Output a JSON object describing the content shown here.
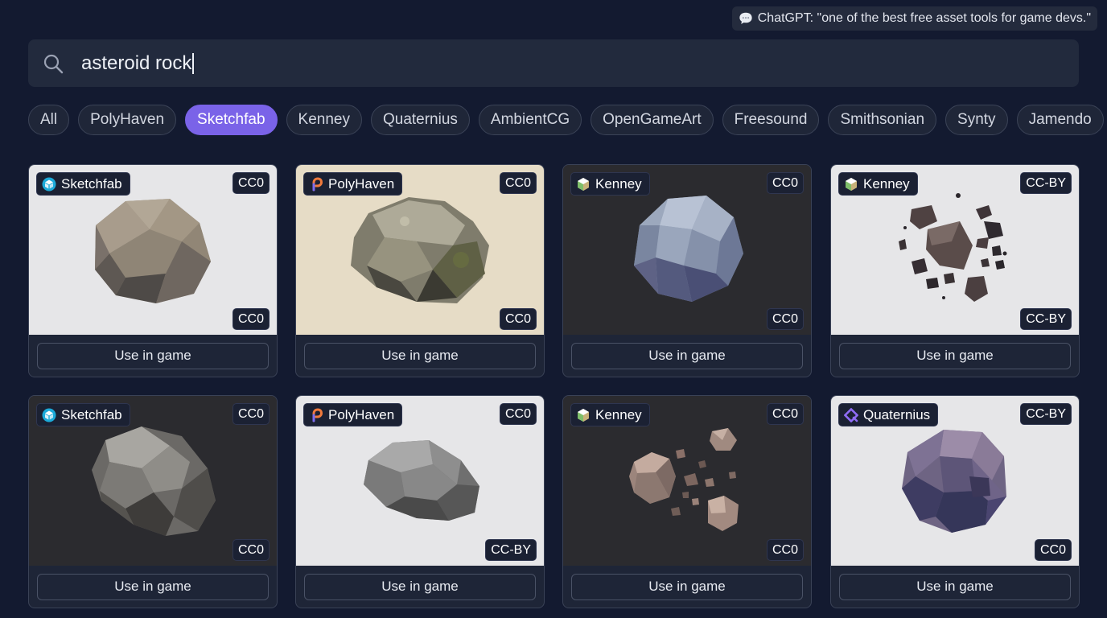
{
  "toast": {
    "icon": "speech-bubble-icon",
    "text": "ChatGPT: \"one of the best free asset tools for game devs.\""
  },
  "search": {
    "icon": "search-icon",
    "value": "asteroid rock"
  },
  "filters": [
    "All",
    "PolyHaven",
    "Sketchfab",
    "Kenney",
    "Quaternius",
    "AmbientCG",
    "OpenGameArt",
    "Freesound",
    "Smithsonian",
    "Synty",
    "Jamendo"
  ],
  "active_filter": "Sketchfab",
  "cards": [
    {
      "source": "Sketchfab",
      "source_icon": "sketchfab-logo-icon",
      "license_top": "CC0",
      "license_bottom": "CC0",
      "action": "Use in game",
      "preview": "low-poly grey asteroid"
    },
    {
      "source": "PolyHaven",
      "source_icon": "polyhaven-logo-icon",
      "license_top": "CC0",
      "license_bottom": "CC0",
      "action": "Use in game",
      "preview": "mossy photoscanned rock"
    },
    {
      "source": "Kenney",
      "source_icon": "kenney-logo-icon",
      "license_top": "CC0",
      "license_bottom": "CC0",
      "action": "Use in game",
      "preview": "low-poly blue asteroid"
    },
    {
      "source": "Kenney",
      "source_icon": "kenney-logo-icon",
      "license_top": "CC-BY",
      "license_bottom": "CC-BY",
      "action": "Use in game",
      "preview": "shattered asteroid fragments"
    },
    {
      "source": "Sketchfab",
      "source_icon": "sketchfab-logo-icon",
      "license_top": "CC0",
      "license_bottom": "CC0",
      "action": "Use in game",
      "preview": "scanned granite rock"
    },
    {
      "source": "PolyHaven",
      "source_icon": "polyhaven-logo-icon",
      "license_top": "CC0",
      "license_bottom": "CC-BY",
      "action": "Use in game",
      "preview": "grey scanned rock"
    },
    {
      "source": "Kenney",
      "source_icon": "kenney-logo-icon",
      "license_top": "CC0",
      "license_bottom": "CC0",
      "action": "Use in game",
      "preview": "low-poly asteroid cluster"
    },
    {
      "source": "Quaternius",
      "source_icon": "quaternius-logo-icon",
      "license_top": "CC-BY",
      "license_bottom": "CC0",
      "action": "Use in game",
      "preview": "purple low-poly asteroid"
    }
  ],
  "colors": {
    "background": "#131a30",
    "accent": "#7a63e8",
    "panel": "#1e2537"
  }
}
